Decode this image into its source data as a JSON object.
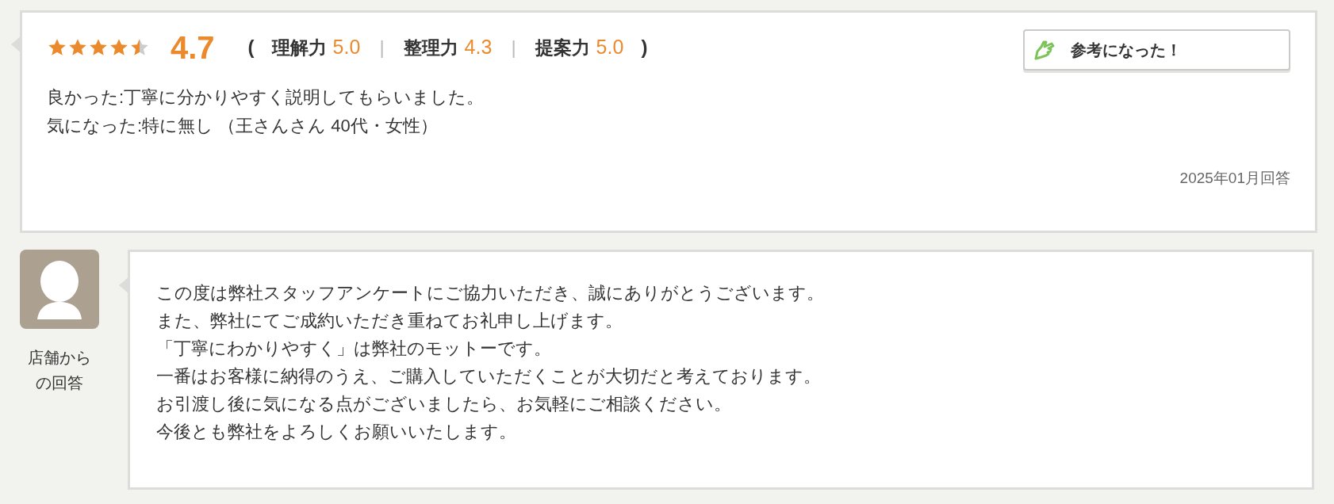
{
  "review": {
    "stars": 4.5,
    "score": "4.7",
    "open_paren": "(",
    "close_paren": ")",
    "subscores": [
      {
        "label": "理解力",
        "value": "5.0"
      },
      {
        "label": "整理力",
        "value": "4.3"
      },
      {
        "label": "提案力",
        "value": "5.0"
      }
    ],
    "separator": "|",
    "helpful_button": "参考になった！",
    "comments": [
      "良かった:丁寧に分かりやすく説明してもらいました。",
      "気になった:特に無し （王さんさん 40代・女性）"
    ],
    "date": "2025年01月回答"
  },
  "reply": {
    "author_label": [
      "店舗から",
      "の回答"
    ],
    "lines": [
      "この度は弊社スタッフアンケートにご協力いただき、誠にありがとうございます。",
      "また、弊社にてご成約いただき重ねてお礼申し上げます。",
      "「丁寧にわかりやすく」は弊社のモットーです。",
      "一番はお客様に納得のうえ、ご購入していただくことが大切だと考えております。",
      "お引渡し後に気になる点がございましたら、お気軽にご相談ください。",
      "今後とも弊社をよろしくお願いいたします。"
    ]
  }
}
